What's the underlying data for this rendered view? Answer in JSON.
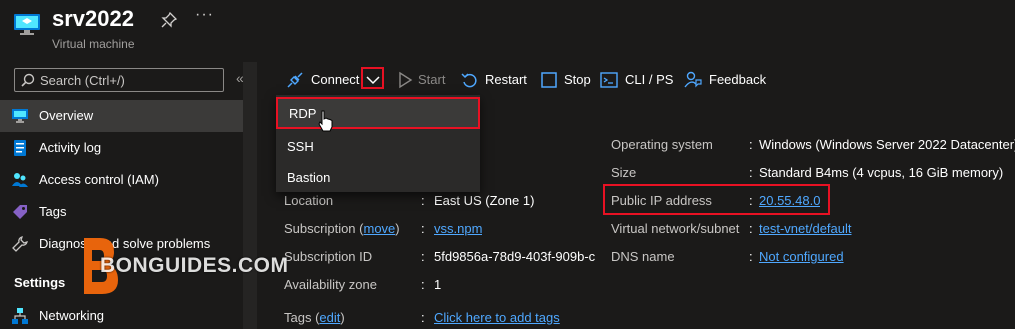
{
  "header": {
    "title": "srv2022",
    "subtitle": "Virtual machine",
    "more": "···"
  },
  "sidebar": {
    "search_placeholder": "Search (Ctrl+/)",
    "collapse_glyph": "«",
    "items": [
      {
        "label": "Overview",
        "icon": "monitor-icon",
        "selected": true
      },
      {
        "label": "Activity log",
        "icon": "activity-log-icon"
      },
      {
        "label": "Access control (IAM)",
        "icon": "people-icon"
      },
      {
        "label": "Tags",
        "icon": "tag-icon"
      },
      {
        "label": "Diagnose and solve problems",
        "icon": "wrench-icon"
      }
    ],
    "section_settings": "Settings",
    "settings_items": [
      {
        "label": "Networking",
        "icon": "networking-icon"
      }
    ]
  },
  "toolbar": {
    "connect": "Connect",
    "start": "Start",
    "restart": "Restart",
    "stop": "Stop",
    "cli": "CLI / PS",
    "feedback": "Feedback"
  },
  "connect_menu": {
    "items": [
      "RDP",
      "SSH",
      "Bastion"
    ],
    "highlighted": "RDP"
  },
  "essentials": {
    "left": [
      {
        "key": "Location",
        "value": "East US (Zone 1)"
      },
      {
        "key": "Subscription",
        "key_link": "move",
        "value": "vss.npm",
        "link": true
      },
      {
        "key": "Subscription ID",
        "value": "5fd9856a-78d9-403f-909b-c"
      },
      {
        "key": "Availability zone",
        "value": "1"
      },
      {
        "key": "Tags",
        "key_link": "edit",
        "value": "Click here to add tags",
        "link": true
      }
    ],
    "right": [
      {
        "key": "Operating system",
        "value": "Windows (Windows Server 2022 Datacenter)"
      },
      {
        "key": "Size",
        "value": "Standard B4ms (4 vcpus, 16 GiB memory)"
      },
      {
        "key": "Public IP address",
        "value": "20.55.48.0",
        "link": true
      },
      {
        "key": "Virtual network/subnet",
        "value": "test-vnet/default",
        "link": true
      },
      {
        "key": "DNS name",
        "value": "Not configured",
        "link": true
      }
    ],
    "partial_value": "g",
    "colon": ":"
  },
  "watermark": {
    "text": "BONGUIDES.COM"
  },
  "colors": {
    "accent": "#0078d4",
    "link": "#4fa8ff",
    "highlight": "#e81123"
  }
}
